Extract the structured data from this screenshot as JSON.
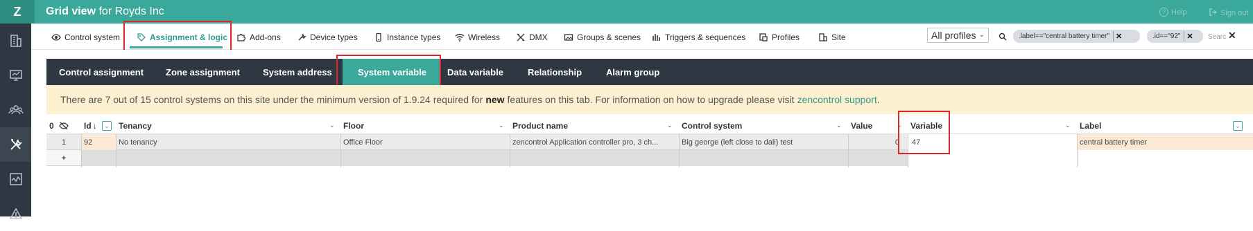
{
  "app": {
    "logo": "Z",
    "title_bold": "Grid view",
    "title_rest": "for Royds Inc",
    "help": "Help",
    "signout": "Sign out"
  },
  "sidebar": {
    "items": [
      {
        "icon": "building-icon"
      },
      {
        "icon": "monitor-icon"
      },
      {
        "icon": "users-icon"
      },
      {
        "icon": "tools-icon",
        "active": true
      },
      {
        "icon": "report-icon"
      },
      {
        "icon": "warning-icon"
      }
    ]
  },
  "nav": {
    "items": [
      {
        "label": "Control system",
        "icon": "eye-icon"
      },
      {
        "label": "Assignment & logic",
        "icon": "tag-icon",
        "active": true
      },
      {
        "label": "Add-ons",
        "icon": "puzzle-icon"
      },
      {
        "label": "Device types",
        "icon": "wrench-icon"
      },
      {
        "label": "Instance types",
        "icon": "phone-icon"
      },
      {
        "label": "Wireless",
        "icon": "wifi-icon"
      },
      {
        "label": "DMX",
        "icon": "dmx-icon"
      },
      {
        "label": "Groups & scenes",
        "icon": "image-icon"
      },
      {
        "label": "Triggers & sequences",
        "icon": "bars-icon"
      },
      {
        "label": "Profiles",
        "icon": "profile-icon"
      },
      {
        "label": "Site",
        "icon": "site-icon"
      }
    ],
    "profiles_select": "All profiles",
    "filters": [
      ".label==\"central battery timer\"",
      ".id==\"92\""
    ],
    "search_placeholder": "Searc"
  },
  "tabs": [
    {
      "label": "Control assignment"
    },
    {
      "label": "Zone assignment"
    },
    {
      "label": "System address"
    },
    {
      "label": "System variable",
      "active": true
    },
    {
      "label": "Data variable"
    },
    {
      "label": "Relationship"
    },
    {
      "label": "Alarm group"
    }
  ],
  "banner": {
    "text_before": "There are 7 out of 15 control systems on this site under the minimum version of 1.9.24 required for",
    "bold": "new",
    "text_after": "features on this tab. For information on how to upgrade please visit",
    "link": "zencontrol support",
    "end": "."
  },
  "grid": {
    "row_count": "0",
    "columns": [
      "Id",
      "Tenancy",
      "Floor",
      "Product name",
      "Control system",
      "Value",
      "Variable",
      "Label"
    ],
    "sort_indicator": "↓",
    "rows": [
      {
        "num": "1",
        "id": "92",
        "tenancy": "No tenancy",
        "floor": "Office Floor",
        "product_name": "zencontrol Application controller pro, 3 ch...",
        "control_system": "Big george (left close to dali) test",
        "value": "0",
        "variable": "47",
        "label": "central battery timer"
      }
    ],
    "add_row": "+"
  }
}
